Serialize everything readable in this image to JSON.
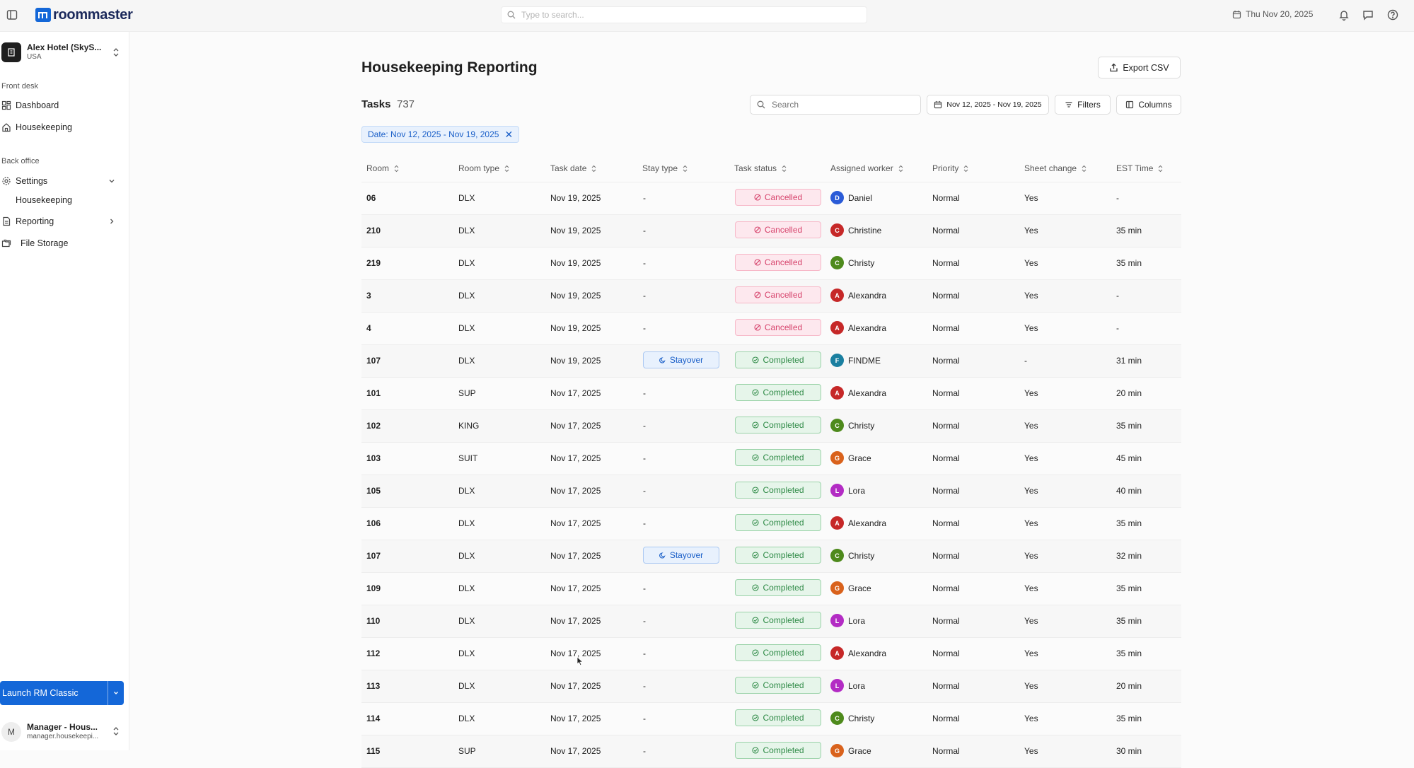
{
  "app": {
    "brand": "roommaster",
    "search_placeholder": "Type to search...",
    "date": "Thu Nov 20, 2025"
  },
  "sidebar": {
    "hotel_name": "Alex Hotel (SkyS...",
    "hotel_country": "USA",
    "front_desk_label": "Front desk",
    "dashboard": "Dashboard",
    "housekeeping": "Housekeeping",
    "back_office_label": "Back office",
    "settings": "Settings",
    "settings_sub_housekeeping": "Housekeeping",
    "reporting": "Reporting",
    "file_storage": "File Storage",
    "launch_label": "Launch RM Classic",
    "user_initial": "M",
    "user_name": "Manager - Hous...",
    "user_email": "manager.housekeepi..."
  },
  "page": {
    "title": "Housekeeping Reporting",
    "export_label": "Export CSV",
    "tasks_label": "Tasks",
    "tasks_count": "737",
    "search_placeholder": "Search",
    "date_range": "Nov 12, 2025 - Nov 19, 2025",
    "filters_label": "Filters",
    "columns_label": "Columns",
    "filter_chip": "Date: Nov 12, 2025 - Nov 19, 2025"
  },
  "colors": {
    "accent": "#1467d8",
    "cancelled": "#d6426b",
    "completed": "#2e8a46"
  },
  "table": {
    "columns": [
      "Room",
      "Room type",
      "Task date",
      "Stay type",
      "Task status",
      "Assigned worker",
      "Priority",
      "Sheet change",
      "EST Time"
    ],
    "rows": [
      {
        "room": "06",
        "type": "DLX",
        "date": "Nov 19, 2025",
        "stay": "-",
        "status": "Cancelled",
        "worker": "Daniel",
        "initial": "D",
        "color": "#2a5bd7",
        "priority": "Normal",
        "sheet": "Yes",
        "est": "-"
      },
      {
        "room": "210",
        "type": "DLX",
        "date": "Nov 19, 2025",
        "stay": "-",
        "status": "Cancelled",
        "worker": "Christine",
        "initial": "C",
        "color": "#c62828",
        "priority": "Normal",
        "sheet": "Yes",
        "est": "35 min"
      },
      {
        "room": "219",
        "type": "DLX",
        "date": "Nov 19, 2025",
        "stay": "-",
        "status": "Cancelled",
        "worker": "Christy",
        "initial": "C",
        "color": "#4e8a1c",
        "priority": "Normal",
        "sheet": "Yes",
        "est": "35 min"
      },
      {
        "room": "3",
        "type": "DLX",
        "date": "Nov 19, 2025",
        "stay": "-",
        "status": "Cancelled",
        "worker": "Alexandra",
        "initial": "A",
        "color": "#c62828",
        "priority": "Normal",
        "sheet": "Yes",
        "est": "-"
      },
      {
        "room": "4",
        "type": "DLX",
        "date": "Nov 19, 2025",
        "stay": "-",
        "status": "Cancelled",
        "worker": "Alexandra",
        "initial": "A",
        "color": "#c62828",
        "priority": "Normal",
        "sheet": "Yes",
        "est": "-"
      },
      {
        "room": "107",
        "type": "DLX",
        "date": "Nov 19, 2025",
        "stay": "Stayover",
        "status": "Completed",
        "worker": "FINDME",
        "initial": "F",
        "color": "#1a7fa0",
        "priority": "Normal",
        "sheet": "-",
        "est": "31 min"
      },
      {
        "room": "101",
        "type": "SUP",
        "date": "Nov 17, 2025",
        "stay": "-",
        "status": "Completed",
        "worker": "Alexandra",
        "initial": "A",
        "color": "#c62828",
        "priority": "Normal",
        "sheet": "Yes",
        "est": "20 min"
      },
      {
        "room": "102",
        "type": "KING",
        "date": "Nov 17, 2025",
        "stay": "-",
        "status": "Completed",
        "worker": "Christy",
        "initial": "C",
        "color": "#4e8a1c",
        "priority": "Normal",
        "sheet": "Yes",
        "est": "35 min"
      },
      {
        "room": "103",
        "type": "SUIT",
        "date": "Nov 17, 2025",
        "stay": "-",
        "status": "Completed",
        "worker": "Grace",
        "initial": "G",
        "color": "#d9621c",
        "priority": "Normal",
        "sheet": "Yes",
        "est": "45 min"
      },
      {
        "room": "105",
        "type": "DLX",
        "date": "Nov 17, 2025",
        "stay": "-",
        "status": "Completed",
        "worker": "Lora",
        "initial": "L",
        "color": "#b32cc4",
        "priority": "Normal",
        "sheet": "Yes",
        "est": "40 min"
      },
      {
        "room": "106",
        "type": "DLX",
        "date": "Nov 17, 2025",
        "stay": "-",
        "status": "Completed",
        "worker": "Alexandra",
        "initial": "A",
        "color": "#c62828",
        "priority": "Normal",
        "sheet": "Yes",
        "est": "35 min"
      },
      {
        "room": "107",
        "type": "DLX",
        "date": "Nov 17, 2025",
        "stay": "Stayover",
        "status": "Completed",
        "worker": "Christy",
        "initial": "C",
        "color": "#4e8a1c",
        "priority": "Normal",
        "sheet": "Yes",
        "est": "32 min"
      },
      {
        "room": "109",
        "type": "DLX",
        "date": "Nov 17, 2025",
        "stay": "-",
        "status": "Completed",
        "worker": "Grace",
        "initial": "G",
        "color": "#d9621c",
        "priority": "Normal",
        "sheet": "Yes",
        "est": "35 min"
      },
      {
        "room": "110",
        "type": "DLX",
        "date": "Nov 17, 2025",
        "stay": "-",
        "status": "Completed",
        "worker": "Lora",
        "initial": "L",
        "color": "#b32cc4",
        "priority": "Normal",
        "sheet": "Yes",
        "est": "35 min"
      },
      {
        "room": "112",
        "type": "DLX",
        "date": "Nov 17, 2025",
        "stay": "-",
        "status": "Completed",
        "worker": "Alexandra",
        "initial": "A",
        "color": "#c62828",
        "priority": "Normal",
        "sheet": "Yes",
        "est": "35 min"
      },
      {
        "room": "113",
        "type": "DLX",
        "date": "Nov 17, 2025",
        "stay": "-",
        "status": "Completed",
        "worker": "Lora",
        "initial": "L",
        "color": "#b32cc4",
        "priority": "Normal",
        "sheet": "Yes",
        "est": "20 min"
      },
      {
        "room": "114",
        "type": "DLX",
        "date": "Nov 17, 2025",
        "stay": "-",
        "status": "Completed",
        "worker": "Christy",
        "initial": "C",
        "color": "#4e8a1c",
        "priority": "Normal",
        "sheet": "Yes",
        "est": "35 min"
      },
      {
        "room": "115",
        "type": "SUP",
        "date": "Nov 17, 2025",
        "stay": "-",
        "status": "Completed",
        "worker": "Grace",
        "initial": "G",
        "color": "#d9621c",
        "priority": "Normal",
        "sheet": "Yes",
        "est": "30 min"
      }
    ]
  }
}
